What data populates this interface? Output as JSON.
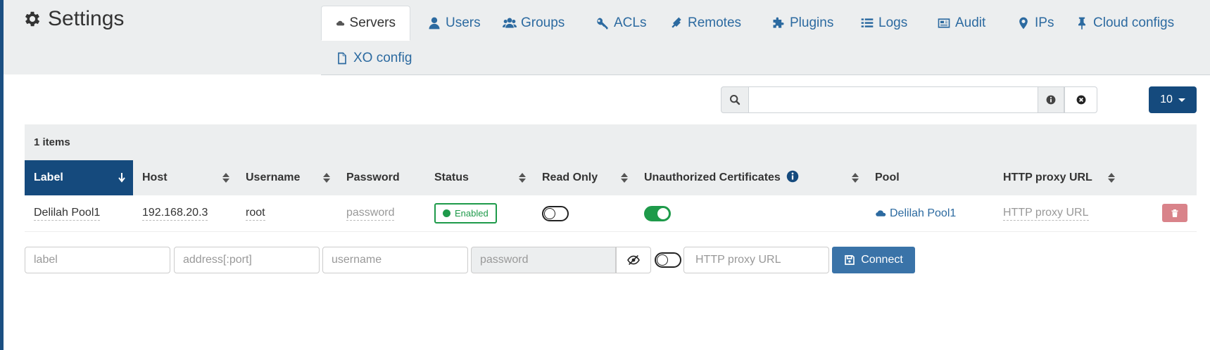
{
  "header": {
    "title": "Settings"
  },
  "tabs": [
    {
      "label": "Servers",
      "icon": "cloud-icon",
      "active": true
    },
    {
      "label": "Users",
      "icon": "user-icon"
    },
    {
      "label": "Groups",
      "icon": "users-icon"
    },
    {
      "label": "ACLs",
      "icon": "key-icon"
    },
    {
      "label": "Remotes",
      "icon": "plug-icon"
    },
    {
      "label": "Plugins",
      "icon": "puzzle-icon"
    },
    {
      "label": "Logs",
      "icon": "list-icon"
    },
    {
      "label": "Audit",
      "icon": "newspaper-icon"
    },
    {
      "label": "IPs",
      "icon": "map-marker-icon"
    },
    {
      "label": "Cloud configs",
      "icon": "thumbtack-icon"
    },
    {
      "label": "XO config",
      "icon": "file-icon"
    }
  ],
  "search": {
    "value": "",
    "placeholder": ""
  },
  "page_size": "10",
  "table": {
    "item_count": "1 items",
    "columns": [
      "Label",
      "Host",
      "Username",
      "Password",
      "Status",
      "Read Only",
      "Unauthorized Certificates",
      "Pool",
      "HTTP proxy URL"
    ],
    "rows": [
      {
        "label": "Delilah Pool1",
        "host": "192.168.20.3",
        "username": "root",
        "password": "password",
        "status": "Enabled",
        "read_only": false,
        "unauthorized_certificates": true,
        "pool": "Delilah Pool1",
        "http_proxy_url": "HTTP proxy URL"
      }
    ]
  },
  "form": {
    "label_placeholder": "label",
    "address_placeholder": "address[:port]",
    "username_placeholder": "username",
    "password_placeholder": "password",
    "proxy_placeholder": "HTTP proxy URL",
    "connect_label": "Connect"
  },
  "colors": {
    "primary": "#154a7d",
    "success": "#1e9a4a",
    "danger": "#d9838a",
    "link": "#2c6aa0"
  }
}
